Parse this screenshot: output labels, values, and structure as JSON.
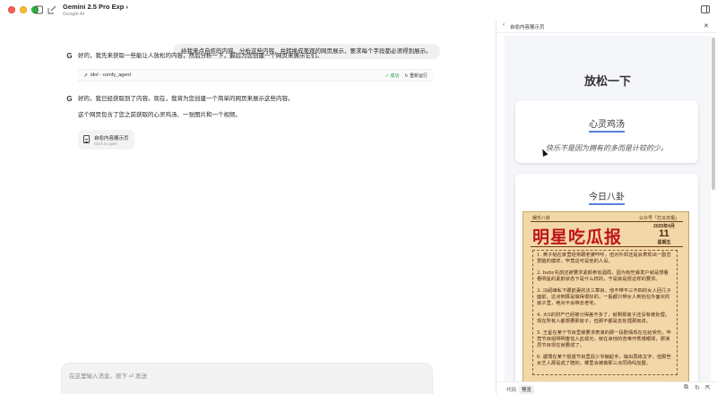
{
  "titlebar": {
    "model_name": "Gemini 2.5 Pro Exp",
    "model_sub": "Google AI",
    "chevron": "›"
  },
  "chat": {
    "user_message": "给我来点自愈的内容，分析这些内容，并转换成美观的网页展示，要求每个字段都必须得到展示。",
    "assistant_1": "好的，我先来获取一些能让人放松的内容，然后分析一下，最后为您创建一个网页来展示它们。",
    "tool_call": {
      "label": "idol - comfy_agent",
      "status": "成功",
      "rerun": "重新运行"
    },
    "assistant_2": "好的，我已经获取到了内容。现在，我将为您创建一个简单的网页来展示这些内容。",
    "assistant_3": "这个网页包含了您之前获取的心灵鸡汤、一张图片和一个视频。",
    "card": {
      "title": "自愈内容展示页",
      "subtitle": "Click to open"
    },
    "input_placeholder": "在这里输入消息，按下 ⏎ 发送"
  },
  "pane": {
    "header_title": "自愈内容展示页",
    "page_title": "放松一下",
    "section1_title": "心灵鸡汤",
    "section1_quote": "快乐不是因为拥有的多而是计较的少。",
    "section2_title": "今日八卦",
    "newspaper": {
      "top_left": "娱乐八卦",
      "top_right": "公众号「打瓜日报」",
      "headline": "明星吃瓜报",
      "date_year": "2025年4月",
      "date_day": "11",
      "date_week": "星期五",
      "paragraphs": [
        "1. 黄子韬在家里经常跟老婆咋呼，但对外却还是会表现出一副恋爱脑的模样，毕竟这可是他的人设。",
        "2. baby先前还被要求素颜参加酒局，因为有些暴发户就是想看看明星的素颜状态下是什么样的，于是就是很这样的要求。",
        "3. 冯绍峰私下跟前妻的法三章目，他不带不三不四的女人回几子面前，这点倒算是做得很好的，一般都只带女人到他在外面买的房子里，绝对不会带去老宅。",
        "4. 大S的财产已经被分得差不多了，就剩那房子还没有被处理，现在所有人都想要那房子，但那不都是去处理那房资。",
        "5. 王星在某个节目里被要求表演的那一段剧情现在在给受伤，毕竟节目组明明害怕入血观光，就在拿他的苦难作秀博眼球，那演员节目现在就要成了。",
        "6. 虞璞在某个姐姐节目里段少爷躺起手，输出再练文字，但那些女艺人那是成了赔的，哪里会被做那三点同场吗加盟。"
      ]
    },
    "tab_code": "代码",
    "tab_preview": "预览"
  },
  "colors": {
    "headline_red": "#c0141c",
    "paper_bg": "#f2d8a8",
    "accent_blue": "#5b7fe0",
    "success_green": "#1a9c4a"
  },
  "icons": {
    "sidebar": "sidebar-toggle-icon",
    "new_chat": "new-chat-icon",
    "google": "G",
    "tool_arrow": "↗",
    "ok": "✓",
    "rerun": "↻",
    "back": "‹",
    "close": "✕",
    "mic": "🎙",
    "copy": "⧉",
    "refresh": "↻",
    "external": "⇱"
  }
}
